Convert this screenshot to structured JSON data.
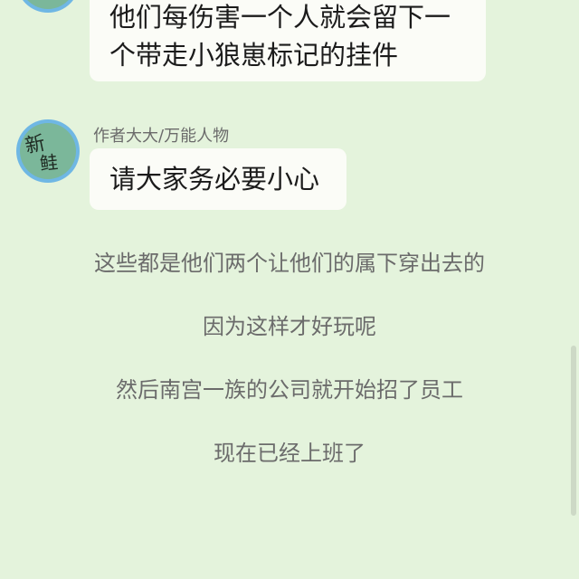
{
  "chat": {
    "messages": [
      {
        "lines": [
          "他们每伤害一个人就会留下一",
          "个带走小狼崽标记的挂件"
        ]
      },
      {
        "sender": "作者大大/万能人物",
        "avatar_text": [
          "新",
          "鲑"
        ],
        "text": "请大家务必要小心"
      }
    ],
    "narration": [
      "这些都是他们两个让他们的属下穿出去的",
      "因为这样才好玩呢",
      "然后南宫一族的公司就开始招了员工",
      "现在已经上班了"
    ]
  },
  "colors": {
    "background": "#e4f3dc",
    "bubble": "#fbfcf7",
    "avatar_ring": "#6fb7e4",
    "avatar_fill": "#7bb79a",
    "narration_text": "#6b6b6b"
  }
}
